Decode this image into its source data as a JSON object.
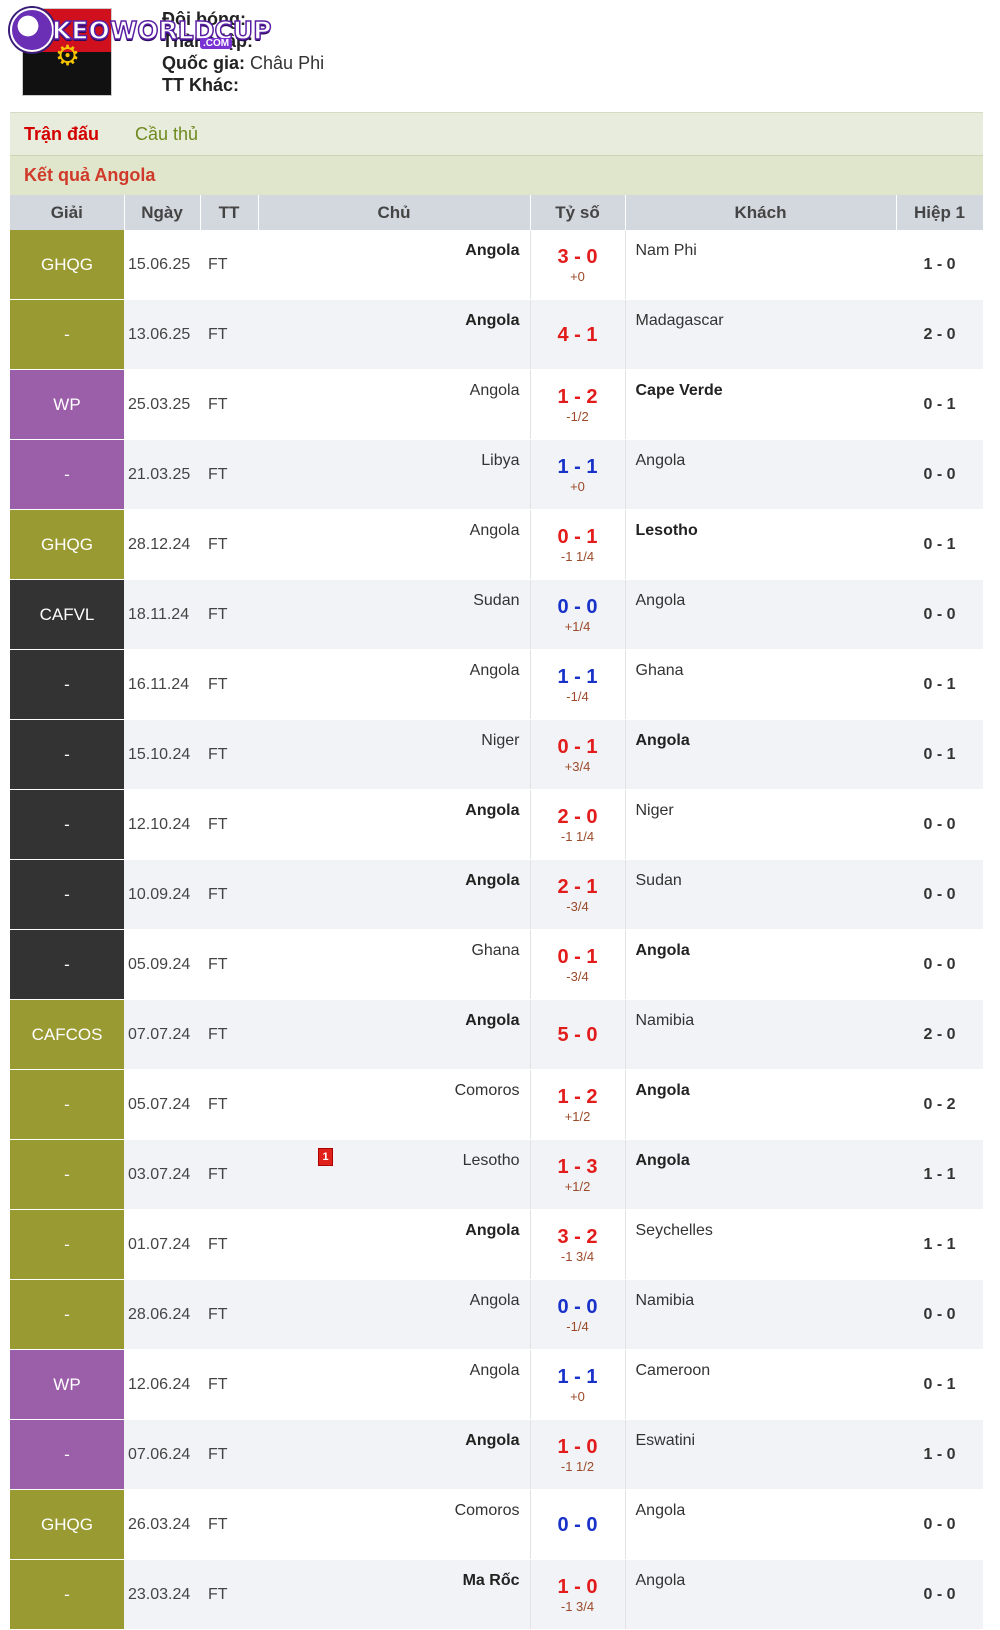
{
  "team": {
    "label_name": "Đội bóng:",
    "label_year": "Thành lập:",
    "label_country": "Quốc gia:",
    "country": "Châu Phi",
    "label_other": "TT Khác:"
  },
  "logo": {
    "text": "KEOWORLDCUP",
    "suffix": ".COM"
  },
  "tabs": [
    "Trận đấu",
    "Cầu thủ"
  ],
  "section_title": "Kết quả Angola",
  "colors": {
    "olive": "#9a9a33",
    "purple": "#9b5ea8",
    "dark": "#333333",
    "win": "#e21b1b",
    "draw": "#1731c9",
    "loss": "#e21b1b"
  },
  "columns": [
    "Giải",
    "Ngày",
    "TT",
    "Chủ",
    "Tỷ số",
    "Khách",
    "Hiệp 1"
  ],
  "matches": [
    {
      "league": "GHQG",
      "date": "15.06.25",
      "status": "FT",
      "home": "Angola",
      "score": "3 - 0",
      "odds": "+0",
      "away": "Nam Phi",
      "ht": "1 - 0",
      "win": "home",
      "color": "olive"
    },
    {
      "league": "-",
      "date": "13.06.25",
      "status": "FT",
      "home": "Angola",
      "score": "4 - 1",
      "odds": "",
      "away": "Madagascar",
      "ht": "2 - 0",
      "win": "home",
      "color": "olive"
    },
    {
      "league": "WP",
      "date": "25.03.25",
      "status": "FT",
      "home": "Angola",
      "score": "1 - 2",
      "odds": "-1/2",
      "away": "Cape Verde",
      "ht": "0 - 1",
      "win": "away",
      "color": "purple"
    },
    {
      "league": "-",
      "date": "21.03.25",
      "status": "FT",
      "home": "Libya",
      "score": "1 - 1",
      "odds": "+0",
      "away": "Angola",
      "ht": "0 - 0",
      "win": "draw",
      "color": "purple"
    },
    {
      "league": "GHQG",
      "date": "28.12.24",
      "status": "FT",
      "home": "Angola",
      "score": "0 - 1",
      "odds": "-1 1/4",
      "away": "Lesotho",
      "ht": "0 - 1",
      "win": "away",
      "color": "olive"
    },
    {
      "league": "CAFVL",
      "date": "18.11.24",
      "status": "FT",
      "home": "Sudan",
      "score": "0 - 0",
      "odds": "+1/4",
      "away": "Angola",
      "ht": "0 - 0",
      "win": "draw",
      "color": "dark"
    },
    {
      "league": "-",
      "date": "16.11.24",
      "status": "FT",
      "home": "Angola",
      "score": "1 - 1",
      "odds": "-1/4",
      "away": "Ghana",
      "ht": "0 - 1",
      "win": "draw",
      "color": "dark"
    },
    {
      "league": "-",
      "date": "15.10.24",
      "status": "FT",
      "home": "Niger",
      "score": "0 - 1",
      "odds": "+3/4",
      "away": "Angola",
      "ht": "0 - 1",
      "win": "away",
      "color": "dark"
    },
    {
      "league": "-",
      "date": "12.10.24",
      "status": "FT",
      "home": "Angola",
      "score": "2 - 0",
      "odds": "-1 1/4",
      "away": "Niger",
      "ht": "0 - 0",
      "win": "home",
      "color": "dark"
    },
    {
      "league": "-",
      "date": "10.09.24",
      "status": "FT",
      "home": "Angola",
      "score": "2 - 1",
      "odds": "-3/4",
      "away": "Sudan",
      "ht": "0 - 0",
      "win": "home",
      "color": "dark"
    },
    {
      "league": "-",
      "date": "05.09.24",
      "status": "FT",
      "home": "Ghana",
      "score": "0 - 1",
      "odds": "-3/4",
      "away": "Angola",
      "ht": "0 - 0",
      "win": "away",
      "color": "dark"
    },
    {
      "league": "CAFCOS",
      "date": "07.07.24",
      "status": "FT",
      "home": "Angola",
      "score": "5 - 0",
      "odds": "",
      "away": "Namibia",
      "ht": "2 - 0",
      "win": "home",
      "color": "olive"
    },
    {
      "league": "-",
      "date": "05.07.24",
      "status": "FT",
      "home": "Comoros",
      "score": "1 - 2",
      "odds": "+1/2",
      "away": "Angola",
      "ht": "0 - 2",
      "win": "away",
      "color": "olive"
    },
    {
      "league": "-",
      "date": "03.07.24",
      "status": "FT",
      "home": "Lesotho",
      "score": "1 - 3",
      "odds": "+1/2",
      "away": "Angola",
      "ht": "1 - 1",
      "win": "away",
      "color": "olive",
      "card": "1"
    },
    {
      "league": "-",
      "date": "01.07.24",
      "status": "FT",
      "home": "Angola",
      "score": "3 - 2",
      "odds": "-1 3/4",
      "away": "Seychelles",
      "ht": "1 - 1",
      "win": "home",
      "color": "olive"
    },
    {
      "league": "-",
      "date": "28.06.24",
      "status": "FT",
      "home": "Angola",
      "score": "0 - 0",
      "odds": "-1/4",
      "away": "Namibia",
      "ht": "0 - 0",
      "win": "draw",
      "color": "olive"
    },
    {
      "league": "WP",
      "date": "12.06.24",
      "status": "FT",
      "home": "Angola",
      "score": "1 - 1",
      "odds": "+0",
      "away": "Cameroon",
      "ht": "0 - 1",
      "win": "draw",
      "color": "purple"
    },
    {
      "league": "-",
      "date": "07.06.24",
      "status": "FT",
      "home": "Angola",
      "score": "1 - 0",
      "odds": "-1 1/2",
      "away": "Eswatini",
      "ht": "1 - 0",
      "win": "home",
      "color": "purple"
    },
    {
      "league": "GHQG",
      "date": "26.03.24",
      "status": "FT",
      "home": "Comoros",
      "score": "0 - 0",
      "odds": "",
      "away": "Angola",
      "ht": "0 - 0",
      "win": "draw",
      "color": "olive"
    },
    {
      "league": "-",
      "date": "23.03.24",
      "status": "FT",
      "home": "Ma Rốc",
      "score": "1 - 0",
      "odds": "-1 3/4",
      "away": "Angola",
      "ht": "0 - 0",
      "win": "home",
      "color": "olive"
    }
  ]
}
